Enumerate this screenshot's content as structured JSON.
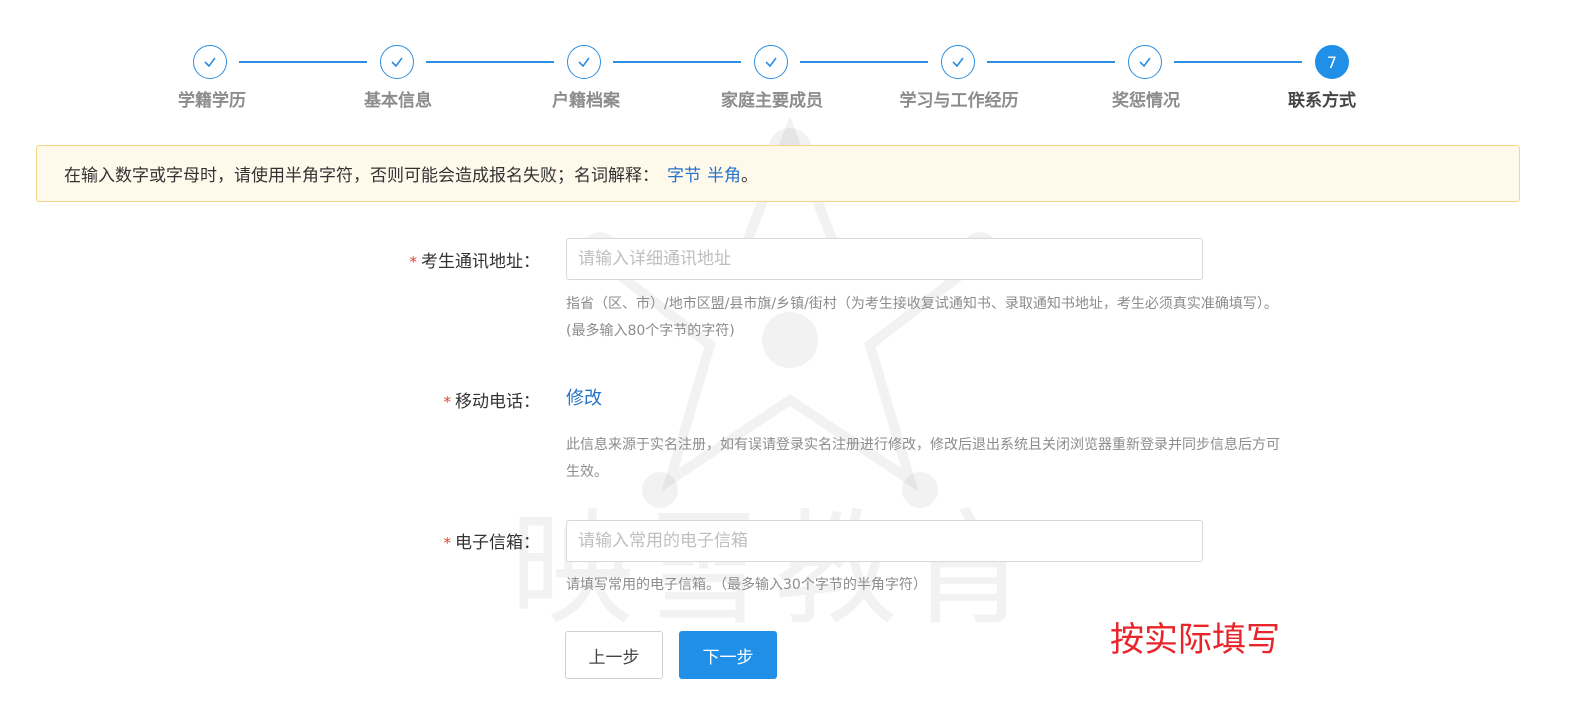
{
  "steps": [
    {
      "label": "学籍学历",
      "status": "done",
      "icon": "check-icon"
    },
    {
      "label": "基本信息",
      "status": "done",
      "icon": "check-icon"
    },
    {
      "label": "户籍档案",
      "status": "done",
      "icon": "check-icon"
    },
    {
      "label": "家庭主要成员",
      "status": "done",
      "icon": "check-icon"
    },
    {
      "label": "学习与工作经历",
      "status": "done",
      "icon": "check-icon"
    },
    {
      "label": "奖惩情况",
      "status": "done",
      "icon": "check-icon"
    },
    {
      "label": "联系方式",
      "status": "current",
      "number": "7"
    }
  ],
  "notice": {
    "text": "在输入数字或字母时，请使用半角字符，否则可能会造成报名失败；名词解释：",
    "link_byte": "字节",
    "link_halfwidth": "半角",
    "suffix": "。"
  },
  "form": {
    "address": {
      "required_mark": "*",
      "label": "考生通讯地址：",
      "placeholder": "请输入详细通讯地址",
      "value": "",
      "hint_line1": "指省（区、市）/地市区盟/县市旗/乡镇/街村（为考生接收复试通知书、录取通知书地址，考生必须真实准确填写）。",
      "hint_line2": "(最多输入80个字节的字符)"
    },
    "mobile": {
      "required_mark": "*",
      "label": "移动电话：",
      "link": "修改",
      "hint_line1": "此信息来源于实名注册，如有误请登录实名注册进行修改，修改后退出系统且关闭浏览器重新登录并同步信息后方可",
      "hint_line2": "生效。"
    },
    "email": {
      "required_mark": "*",
      "label": "电子信箱：",
      "placeholder": "请输入常用的电子信箱",
      "value": "",
      "hint": "请填写常用的电子信箱。（最多输入30个字节的半角字符）"
    }
  },
  "buttons": {
    "prev": "上一步",
    "next": "下一步"
  },
  "annotation": "按实际填写",
  "watermark": "映雪教育",
  "colors": {
    "accent": "#1f8fe8",
    "required": "#e0452e",
    "annotation": "#e8252a",
    "notice_bg": "#fff9ec"
  }
}
